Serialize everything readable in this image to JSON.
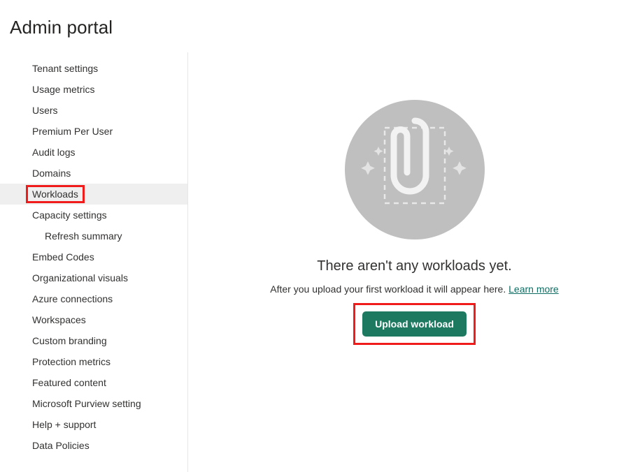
{
  "header": {
    "title": "Admin portal"
  },
  "sidebar": {
    "items": [
      {
        "label": "Tenant settings",
        "sub": false,
        "selected": false,
        "annotated": false
      },
      {
        "label": "Usage metrics",
        "sub": false,
        "selected": false,
        "annotated": false
      },
      {
        "label": "Users",
        "sub": false,
        "selected": false,
        "annotated": false
      },
      {
        "label": "Premium Per User",
        "sub": false,
        "selected": false,
        "annotated": false
      },
      {
        "label": "Audit logs",
        "sub": false,
        "selected": false,
        "annotated": false
      },
      {
        "label": "Domains",
        "sub": false,
        "selected": false,
        "annotated": false
      },
      {
        "label": "Workloads",
        "sub": false,
        "selected": true,
        "annotated": true
      },
      {
        "label": "Capacity settings",
        "sub": false,
        "selected": false,
        "annotated": false
      },
      {
        "label": "Refresh summary",
        "sub": true,
        "selected": false,
        "annotated": false
      },
      {
        "label": "Embed Codes",
        "sub": false,
        "selected": false,
        "annotated": false
      },
      {
        "label": "Organizational visuals",
        "sub": false,
        "selected": false,
        "annotated": false
      },
      {
        "label": "Azure connections",
        "sub": false,
        "selected": false,
        "annotated": false
      },
      {
        "label": "Workspaces",
        "sub": false,
        "selected": false,
        "annotated": false
      },
      {
        "label": "Custom branding",
        "sub": false,
        "selected": false,
        "annotated": false
      },
      {
        "label": "Protection metrics",
        "sub": false,
        "selected": false,
        "annotated": false
      },
      {
        "label": "Featured content",
        "sub": false,
        "selected": false,
        "annotated": false
      },
      {
        "label": "Microsoft Purview setting",
        "sub": false,
        "selected": false,
        "annotated": false
      },
      {
        "label": "Help + support",
        "sub": false,
        "selected": false,
        "annotated": false
      },
      {
        "label": "Data Policies",
        "sub": false,
        "selected": false,
        "annotated": false
      }
    ]
  },
  "main": {
    "illustration_icon": "paperclip-attachment-icon",
    "empty_title": "There aren't any workloads yet.",
    "empty_subtitle": "After you upload your first workload it will appear here.",
    "learn_more_label": "Learn more",
    "upload_button_label": "Upload workload"
  },
  "colors": {
    "accent_green": "#1d7a61",
    "annotation_red": "#f01c1c",
    "link_teal": "#0f6e63",
    "selected_row": "#efefef",
    "illustration_circle": "#bfbfbf",
    "illustration_fill": "#f2f2f2",
    "divider": "#e6e6e6",
    "text": "#323130"
  }
}
